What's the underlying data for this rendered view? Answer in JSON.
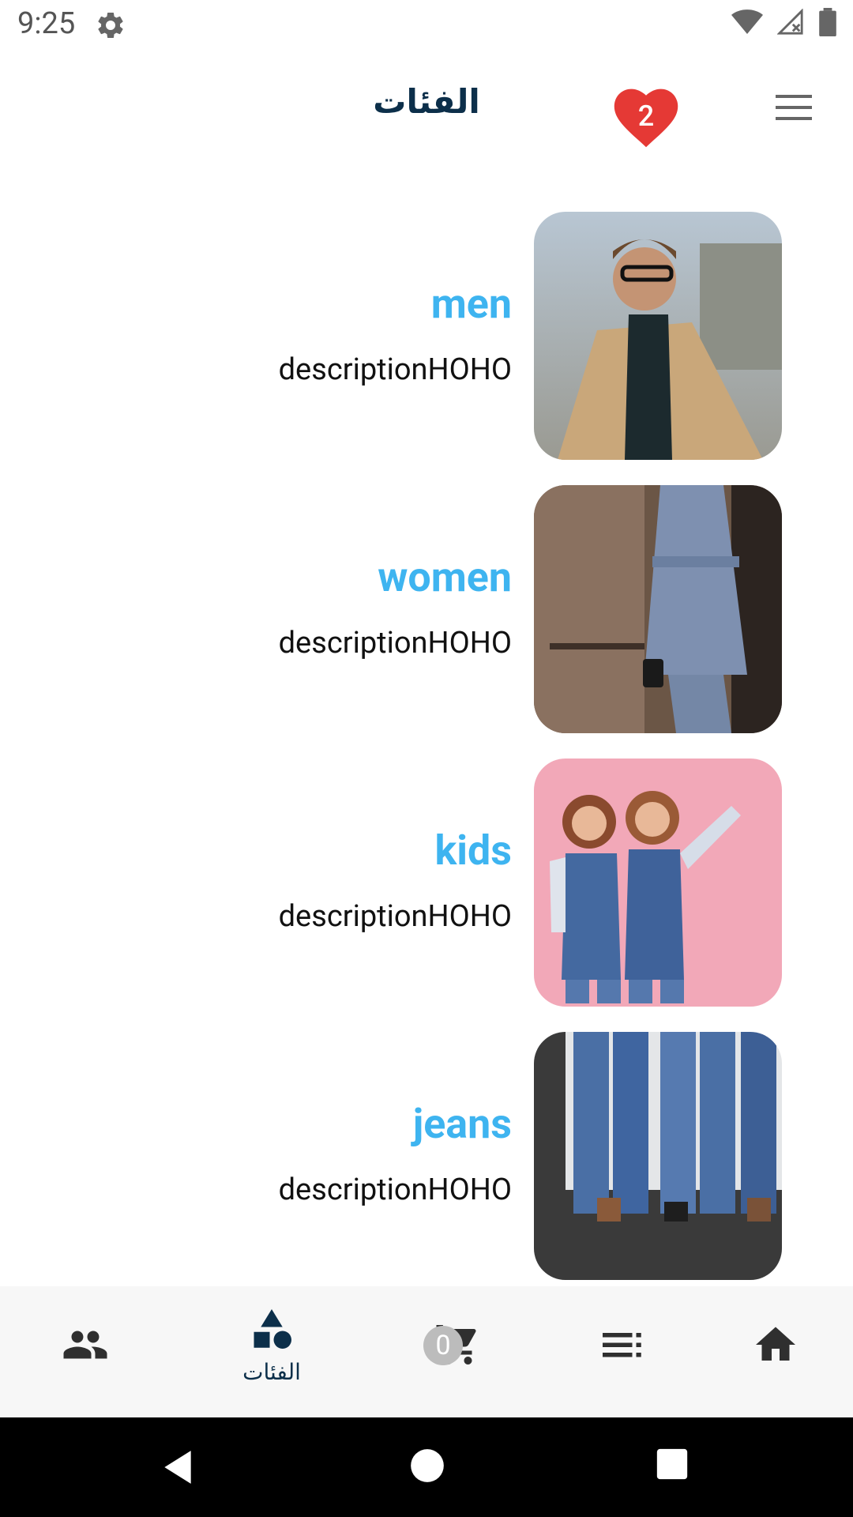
{
  "status_bar": {
    "time": "9:25",
    "icons": [
      "settings-icon",
      "wifi-icon",
      "signal-icon",
      "battery-icon"
    ]
  },
  "app_bar": {
    "title": "الفئات",
    "favorites_count": "2",
    "menu_icon": "hamburger-menu-icon"
  },
  "categories": [
    {
      "name": "men",
      "description": "descriptionHOHO"
    },
    {
      "name": "women",
      "description": "descriptionHOHO"
    },
    {
      "name": "kids",
      "description": "descriptionHOHO"
    },
    {
      "name": "jeans",
      "description": "descriptionHOHO"
    }
  ],
  "bottom_nav": {
    "items": [
      {
        "icon": "people-icon",
        "label": ""
      },
      {
        "icon": "categories-icon",
        "label": "الفئات",
        "active": true
      },
      {
        "icon": "cart-icon",
        "label": "",
        "badge": "0"
      },
      {
        "icon": "list-icon",
        "label": ""
      },
      {
        "icon": "home-icon",
        "label": ""
      }
    ]
  },
  "colors": {
    "accent": "#3eb4f0",
    "primary_dark": "#0c2f4a",
    "heart": "#e53935"
  }
}
